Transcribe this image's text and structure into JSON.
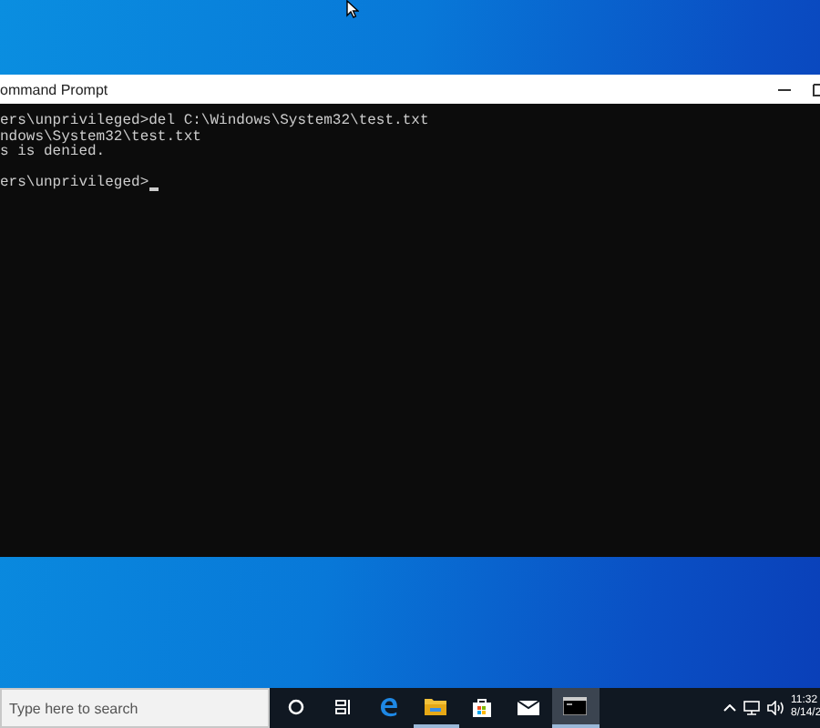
{
  "window": {
    "title": "ommand Prompt",
    "console_blocks": [
      [
        "ers\\unprivileged>del C:\\Windows\\System32\\test.txt",
        "ndows\\System32\\test.txt",
        "s is denied."
      ],
      [
        "ers\\unprivileged>"
      ]
    ]
  },
  "taskbar": {
    "search": {
      "placeholder": "Type here to search"
    },
    "apps": [
      {
        "kind": "cortana",
        "running": false,
        "selected": false
      },
      {
        "kind": "taskview",
        "running": false,
        "selected": false
      },
      {
        "kind": "edge",
        "running": false,
        "selected": false
      },
      {
        "kind": "explorer",
        "running": true,
        "selected": false
      },
      {
        "kind": "store",
        "running": false,
        "selected": false
      },
      {
        "kind": "mail",
        "running": false,
        "selected": false
      },
      {
        "kind": "terminal",
        "running": true,
        "selected": true
      }
    ],
    "clock": {
      "time": "11:32",
      "date": "8/14/2"
    }
  }
}
